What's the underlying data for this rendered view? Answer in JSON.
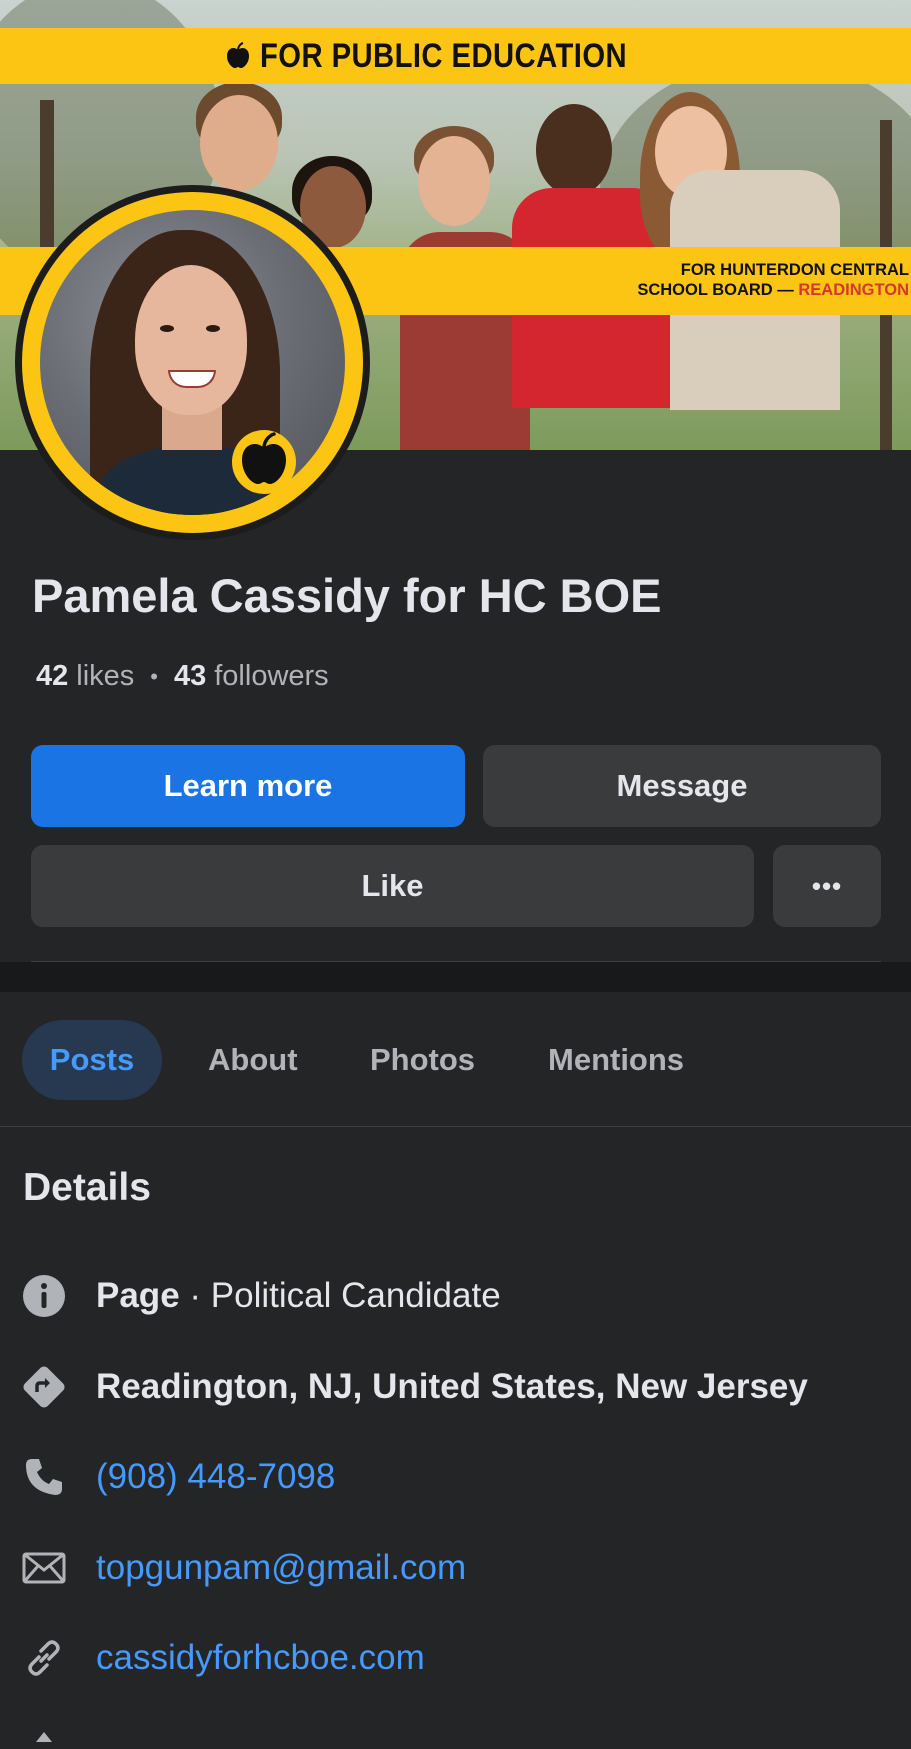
{
  "cover": {
    "top_banner": "FOR PUBLIC EDUCATION",
    "mid_banner_line1": "FOR HUNTERDON CENTRAL",
    "mid_banner_line2_a": "SCHOOL BOARD — ",
    "mid_banner_line2_b": "READINGTON",
    "banner_color": "#fcc514",
    "accent_red": "#d6382f"
  },
  "page": {
    "name": "Pamela Cassidy for HC BOE",
    "likes_count": "42",
    "likes_label": "likes",
    "separator": "•",
    "followers_count": "43",
    "followers_label": "followers"
  },
  "actions": {
    "learn_more": "Learn more",
    "message": "Message",
    "like": "Like",
    "more": "•••",
    "primary_color": "#1b74e4"
  },
  "tabs": [
    {
      "label": "Posts",
      "active": true
    },
    {
      "label": "About",
      "active": false
    },
    {
      "label": "Photos",
      "active": false
    },
    {
      "label": "Mentions",
      "active": false
    }
  ],
  "details": {
    "title": "Details",
    "page_type_label": "Page",
    "page_type_sep": " · ",
    "page_type_value": "Political Candidate",
    "address": "Readington, NJ, United States, New Jersey",
    "phone": "(908) 448-7098",
    "email": "topgunpam@gmail.com",
    "website": "cassidyforhcboe.com",
    "icons": [
      "info-icon",
      "directions-icon",
      "phone-icon",
      "mail-icon",
      "link-icon"
    ],
    "link_color": "#4599ff"
  }
}
